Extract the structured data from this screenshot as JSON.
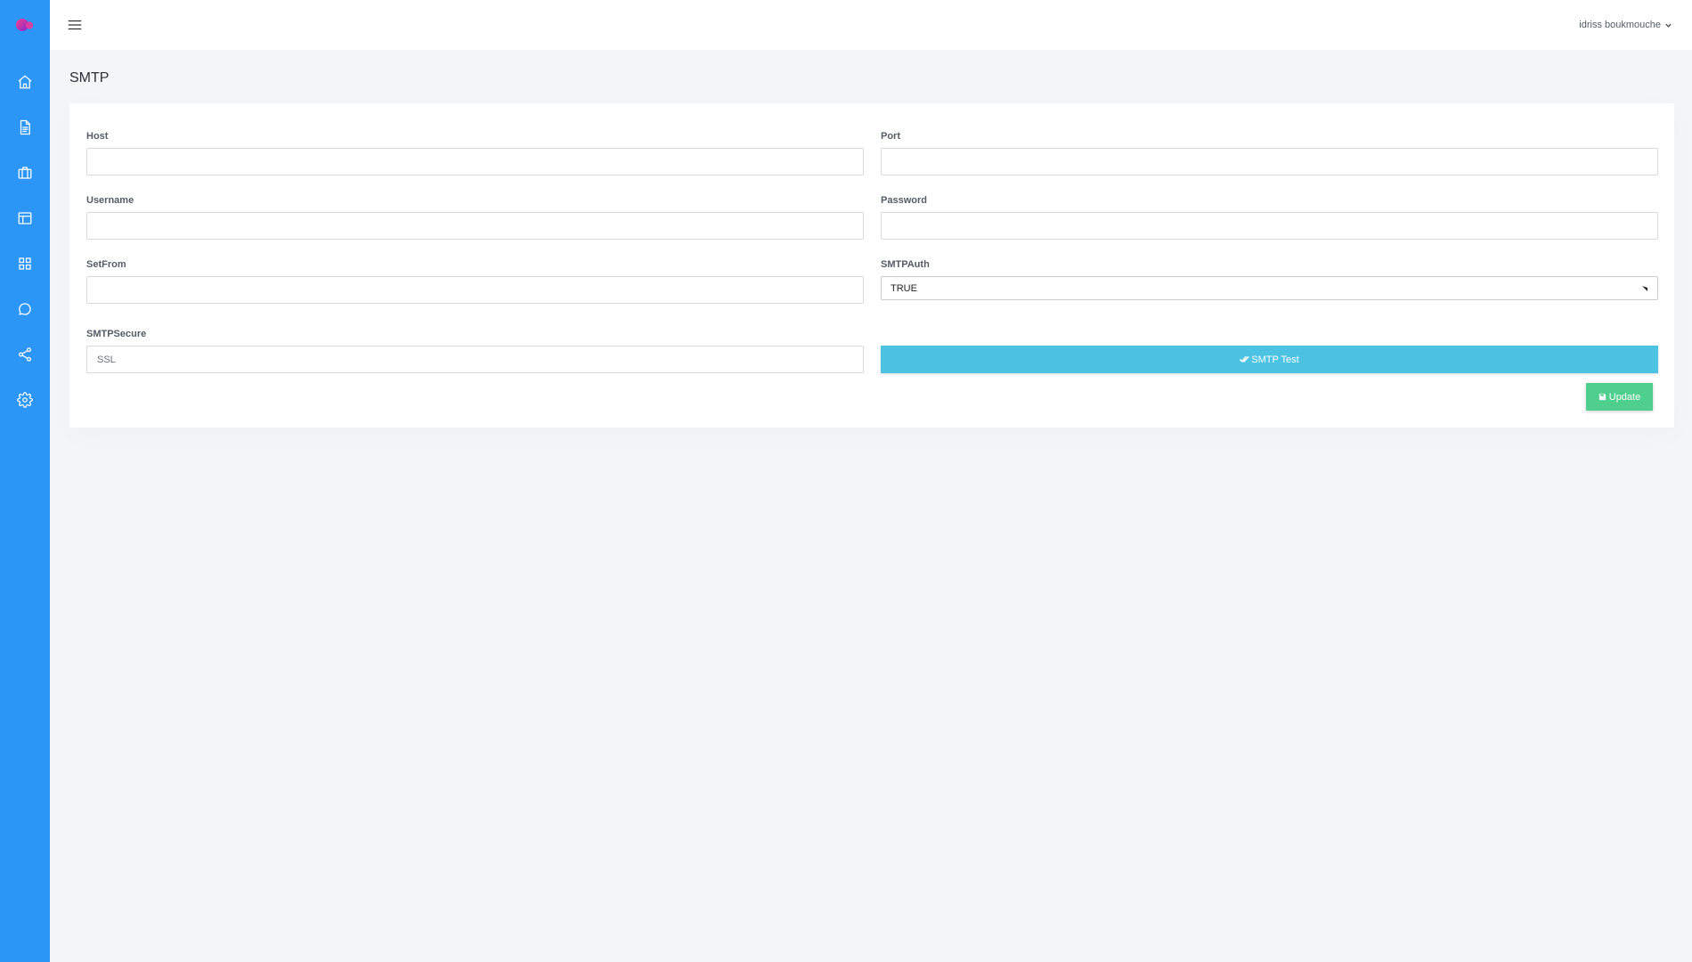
{
  "header": {
    "user_name": "idriss boukmouche"
  },
  "sidebar": {
    "items": [
      {
        "name": "home-icon"
      },
      {
        "name": "document-icon"
      },
      {
        "name": "briefcase-icon"
      },
      {
        "name": "layout-icon"
      },
      {
        "name": "grid-icon"
      },
      {
        "name": "chat-icon"
      },
      {
        "name": "share-icon"
      },
      {
        "name": "gear-icon"
      }
    ]
  },
  "page": {
    "title": "SMTP"
  },
  "form": {
    "host": {
      "label": "Host",
      "value": "",
      "placeholder": ""
    },
    "port": {
      "label": "Port",
      "value": "",
      "placeholder": ""
    },
    "username": {
      "label": "Username",
      "value": "",
      "placeholder": ""
    },
    "password": {
      "label": "Password",
      "value": "",
      "placeholder": ""
    },
    "setfrom": {
      "label": "SetFrom",
      "value": "",
      "placeholder": ""
    },
    "smtpauth": {
      "label": "SMTPAuth",
      "selected": "TRUE"
    },
    "smtpsecure": {
      "label": "SMTPSecure",
      "value": "",
      "placeholder": "SSL"
    },
    "test_button": "SMTP Test",
    "update_button": "Update"
  },
  "colors": {
    "sidebar": "#2b96f5",
    "test_button": "#4cc3e3",
    "update_button": "#4fcf8e"
  }
}
